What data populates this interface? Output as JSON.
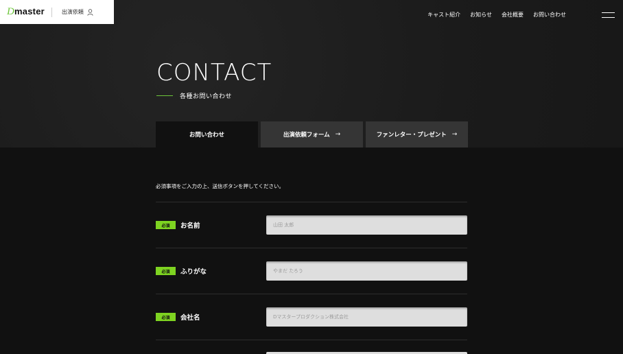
{
  "header": {
    "logo_d": "D",
    "logo_text": "master",
    "appear_link": "出演依頼",
    "nav": [
      "キャスト紹介",
      "お知らせ",
      "会社概要",
      "お問い合わせ"
    ]
  },
  "hero": {
    "title": "CONTACT",
    "subtitle": "各種お問い合わせ"
  },
  "tabs": [
    {
      "label": "お問い合わせ",
      "arrow": ""
    },
    {
      "label": "出演依頼フォーム",
      "arrow": "→"
    },
    {
      "label": "ファンレター・プレゼント",
      "arrow": "→"
    }
  ],
  "form": {
    "instructions": "必須事項をご入力の上、送信ボタンを押してください。",
    "required_badge": "必須",
    "fields": [
      {
        "label": "お名前",
        "placeholder": "山田 太郎"
      },
      {
        "label": "ふりがな",
        "placeholder": "やまだ たろう"
      },
      {
        "label": "会社名",
        "placeholder": "Dマスタープロダクション株式会社"
      }
    ]
  },
  "colors": {
    "accent": "#7ed321",
    "hero_bg": "#1d1d1d",
    "page_bg": "#111111"
  }
}
